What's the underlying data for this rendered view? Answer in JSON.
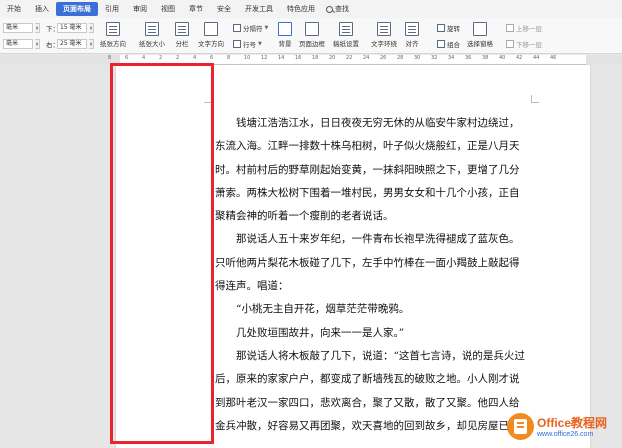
{
  "menu": {
    "tabs": [
      "开始",
      "插入",
      "页面布局",
      "引用",
      "审阅",
      "视图",
      "章节",
      "安全",
      "开发工具",
      "特色应用"
    ],
    "active_tab": "页面布局",
    "search_label": "查找"
  },
  "toolbar": {
    "top_label": "上：",
    "top_value": "毫米",
    "bottom_label": "下：",
    "bottom_value": "15 毫米",
    "left_label": "左：",
    "left_value": "毫米",
    "right_label": "右：",
    "right_value": "25 毫米",
    "buttons": [
      {
        "id": "orientation",
        "label": "纸张方向"
      },
      {
        "id": "size",
        "label": "纸张大小"
      },
      {
        "id": "columns",
        "label": "分栏"
      },
      {
        "id": "textdir",
        "label": "文字方向"
      },
      {
        "id": "background",
        "label": "背景"
      },
      {
        "id": "border",
        "label": "页面边框"
      },
      {
        "id": "draft",
        "label": "稿纸设置"
      },
      {
        "id": "wrap",
        "label": "文字环绕"
      },
      {
        "id": "align",
        "label": "对齐"
      }
    ],
    "small_buttons": {
      "separator": "分隔符",
      "lineno": "行号",
      "rotate": "旋转",
      "combine": "组合",
      "select_pane": "选择窗格",
      "bring_up": "上移一层",
      "send_down": "下移一层"
    }
  },
  "ruler": {
    "ticks": [
      "8",
      "6",
      "4",
      "2",
      "2",
      "4",
      "6",
      "8",
      "10",
      "12",
      "14",
      "16",
      "18",
      "20",
      "22",
      "24",
      "26",
      "28",
      "30",
      "32",
      "34",
      "36",
      "38",
      "40",
      "42",
      "44",
      "46"
    ]
  },
  "document": {
    "lines": [
      "钱塘江浩浩江水，日日夜夜无穷无休的从临安牛家村边绕过，",
      "东流入海。江畔一排数十株乌桕树，叶子似火烧般红，正是八月天",
      "时。村前村后的野草刚起始变黄，一抹斜阳映照之下，更增了几分",
      "萧索。两株大松树下围着一堆村民，男男女女和十几个小孩，正自",
      "聚精会神的听着一个瘦削的老者说话。",
      "那说话人五十来岁年纪，一件青布长袍早洗得褪成了蓝灰色。",
      "只听他两片梨花木板碰了几下，左手中竹棒在一面小羯鼓上敲起得",
      "得连声。唱道：",
      "“小桃无主自开花，烟草茫茫带晚鸦。",
      "几处败垣围故井，向来一一是人家。”",
      "那说话人将木板敲了几下，说道：“这首七言诗，说的是兵火过",
      "后，原来的家家户户，都变成了断墙残瓦的破败之地。小人刚才说",
      "到那叶老汉一家四口，悲欢离合，聚了又散，散了又聚。他四人给",
      "金兵冲散，好容易又再团聚，欢天喜地的回到故乡，却见房屋已给"
    ],
    "indented": [
      0,
      5,
      8,
      9,
      10
    ]
  },
  "watermark": {
    "brand": "Office教程网",
    "url": "www.office26.com"
  }
}
